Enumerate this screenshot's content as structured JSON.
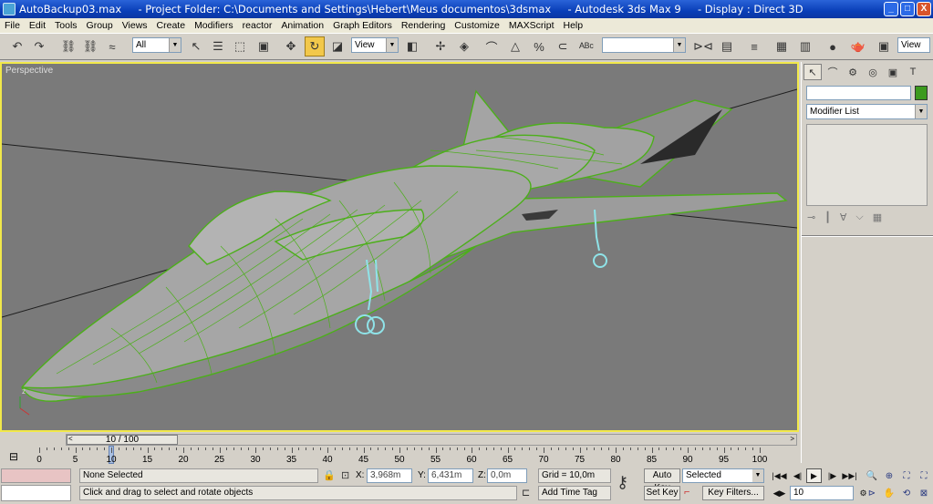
{
  "window": {
    "title": "AutoBackup03.max     - Project Folder: C:\\Documents and Settings\\Hebert\\Meus documentos\\3dsmax     - Autodesk 3ds Max 9     - Display : Direct 3D",
    "controls": [
      "_",
      "□",
      "X"
    ]
  },
  "menu": [
    "File",
    "Edit",
    "Tools",
    "Group",
    "Views",
    "Create",
    "Modifiers",
    "reactor",
    "Animation",
    "Graph Editors",
    "Rendering",
    "Customize",
    "MAXScript",
    "Help"
  ],
  "toolbar": {
    "selection_filter": "All",
    "reference_coord": "View",
    "named_selection": "",
    "view_button": "View"
  },
  "viewport": {
    "label": "Perspective",
    "axis_label": "z",
    "border_color": "#f1e84a",
    "background": "#7a7a7a",
    "wireframe_color": "#4caf1a",
    "gear_color": "#8fe3e8"
  },
  "command_panel": {
    "tabs": [
      "create-icon",
      "modify-icon",
      "hierarchy-icon",
      "motion-icon",
      "display-icon",
      "utilities-icon"
    ],
    "object_name": "",
    "object_color": "#3c9a1e",
    "modifier_list": "Modifier List"
  },
  "time_slider": {
    "position": "10 / 100",
    "current": 10,
    "total": 100
  },
  "trackbar": {
    "labels": [
      "0",
      "5",
      "10",
      "15",
      "20",
      "25",
      "30",
      "35",
      "40",
      "45",
      "50",
      "55",
      "60",
      "65",
      "70",
      "75",
      "80",
      "85",
      "90",
      "95",
      "100"
    ]
  },
  "status": {
    "selection": "None Selected",
    "prompt": "Click and drag to select and rotate objects",
    "x_label": "X:",
    "x_value": "3,968m",
    "y_label": "Y:",
    "y_value": "6,431m",
    "z_label": "Z:",
    "z_value": "0,0m",
    "grid": "Grid = 10,0m",
    "add_time_tag": "Add Time Tag",
    "auto_key": "Auto Key",
    "set_key": "Set Key",
    "key_selection": "Selected",
    "key_filters": "Key Filters...",
    "frame": "10"
  }
}
